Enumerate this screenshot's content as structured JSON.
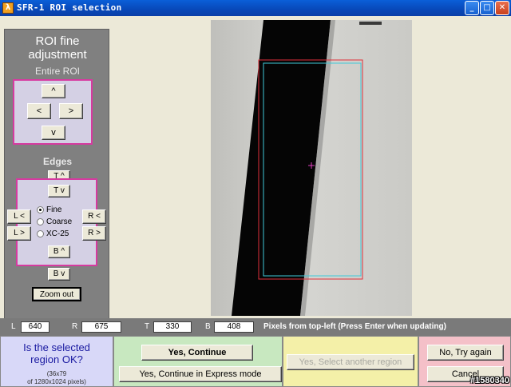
{
  "window": {
    "title": "SFR-1 ROI selection",
    "app_icon": "matlab-icon"
  },
  "left_panel": {
    "title_line1": "ROI fine",
    "title_line2": "adjustment",
    "entire_roi": {
      "title": "Entire ROI",
      "up": "^",
      "left": "<",
      "right": ">",
      "down": "v"
    },
    "edges": {
      "title": "Edges",
      "top_up": "T ^",
      "top_down": "T v",
      "left_left": "L <",
      "left_right": "L >",
      "right_left": "R <",
      "right_right": "R >",
      "bottom_up": "B ^",
      "bottom_down": "B v",
      "radio": [
        {
          "label": "Fine",
          "selected": true
        },
        {
          "label": "Coarse",
          "selected": false
        },
        {
          "label": "XC-25",
          "selected": false
        }
      ]
    },
    "zoom_out": "Zoom out"
  },
  "coords": {
    "L_label": "L",
    "L_value": "640",
    "R_label": "R",
    "R_value": "675",
    "T_label": "T",
    "T_value": "330",
    "B_label": "B",
    "B_value": "408",
    "hint": "Pixels from top-left  (Press Enter when updating)"
  },
  "bottom": {
    "question_line1": "Is the selected",
    "question_line2": "region OK?",
    "size_line1": "(36x79",
    "size_line2": "of 1280x1024 pixels)",
    "yes_continue": "Yes, Continue",
    "yes_express": "Yes, Continue in Express mode",
    "select_another": "Yes, Select another region",
    "no_try": "No, Try again",
    "cancel": "Cancel"
  },
  "watermark": "#1580340"
}
